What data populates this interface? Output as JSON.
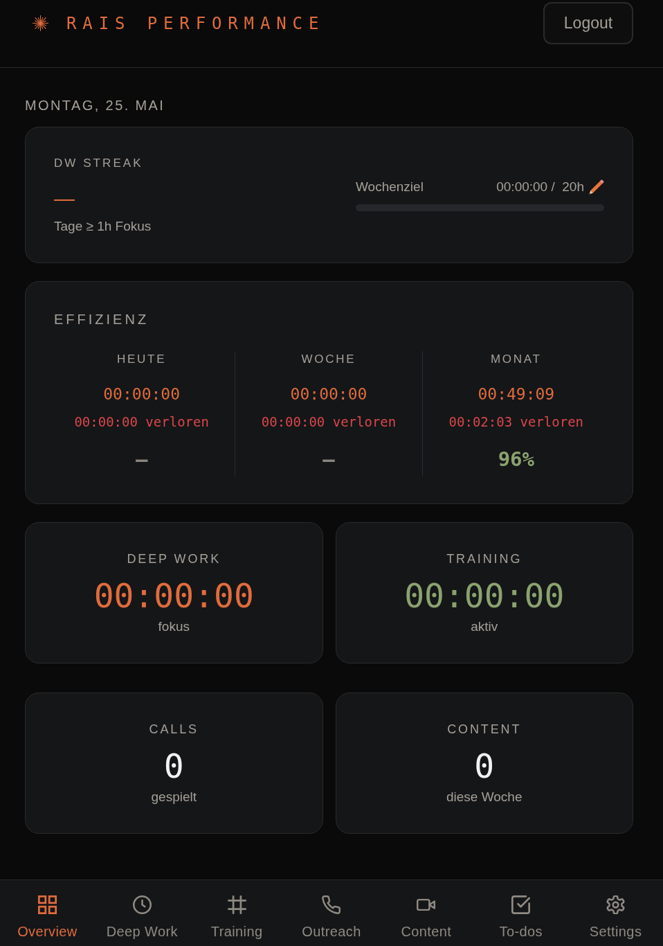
{
  "header": {
    "title": "RAIS PERFORMANCE",
    "logout": "Logout"
  },
  "date": "MONTAG, 25. MAI",
  "streak": {
    "title": "DW STREAK",
    "value": "—",
    "caption": "Tage ≥ 1h Fokus",
    "goal": {
      "label": "Wochenziel",
      "value": "00:00:00 /  20h",
      "level": 0
    }
  },
  "efficiency": {
    "title": "EFFIZIENZ",
    "columns": [
      {
        "label": "HEUTE",
        "time": "00:00:00",
        "lost": "00:00:00 verloren",
        "rate": "—",
        "kind": "empty"
      },
      {
        "label": "WOCHE",
        "time": "00:00:00",
        "lost": "00:00:00 verloren",
        "rate": "—",
        "kind": "empty"
      },
      {
        "label": "MONAT",
        "time": "00:49:09",
        "lost": "00:02:03 verloren",
        "rate": "96%",
        "kind": "percent"
      }
    ]
  },
  "timers": [
    {
      "label": "DEEP WORK",
      "value": "00:00:00",
      "caption": "fokus",
      "color": "#e06c3c"
    },
    {
      "label": "TRAINING",
      "value": "00:00:00",
      "caption": "aktiv",
      "color": "#8ba26f"
    }
  ],
  "counters": [
    {
      "label": "CALLS",
      "value": "0",
      "caption": "gespielt"
    },
    {
      "label": "CONTENT",
      "value": "0",
      "caption": "diese Woche"
    }
  ],
  "nav": [
    {
      "label": "Overview",
      "selected": true
    },
    {
      "label": "Deep Work",
      "selected": false
    },
    {
      "label": "Training",
      "selected": false
    },
    {
      "label": "Outreach",
      "selected": false
    },
    {
      "label": "Content",
      "selected": false
    },
    {
      "label": "To-dos",
      "selected": false
    },
    {
      "label": "Settings",
      "selected": false
    }
  ]
}
